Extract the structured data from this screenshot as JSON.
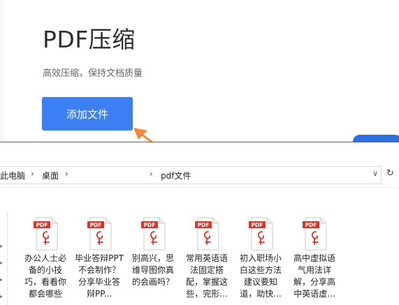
{
  "web": {
    "title": "PDF压缩",
    "subtitle": "高效压缩，保持文档质量",
    "add_button_label": "添加文件",
    "accent_color": "#3b7ff2",
    "arrow_color": "#f08a3a"
  },
  "explorer": {
    "breadcrumbs": [
      "此电脑",
      "桌面",
      "pdf文件"
    ],
    "files": [
      {
        "name": "办公人士必备的小技巧，看看你都会哪些",
        "icon": "pdf-file-icon"
      },
      {
        "name": "毕业答辩PPT不会制作？分享毕业答辩PP...",
        "icon": "pdf-file-icon"
      },
      {
        "name": "别高兴，思维导图你真的会画吗？",
        "icon": "pdf-file-icon"
      },
      {
        "name": "常用英语语法固定搭配，掌握这些，完形...",
        "icon": "pdf-file-icon"
      },
      {
        "name": "初入职场小白这些方法建议要知道，助快...",
        "icon": "pdf-file-icon"
      },
      {
        "name": "高中虚拟语气用法详解，分享高中英语虚...",
        "icon": "pdf-file-icon"
      }
    ],
    "pdf_badge": "PDF"
  }
}
